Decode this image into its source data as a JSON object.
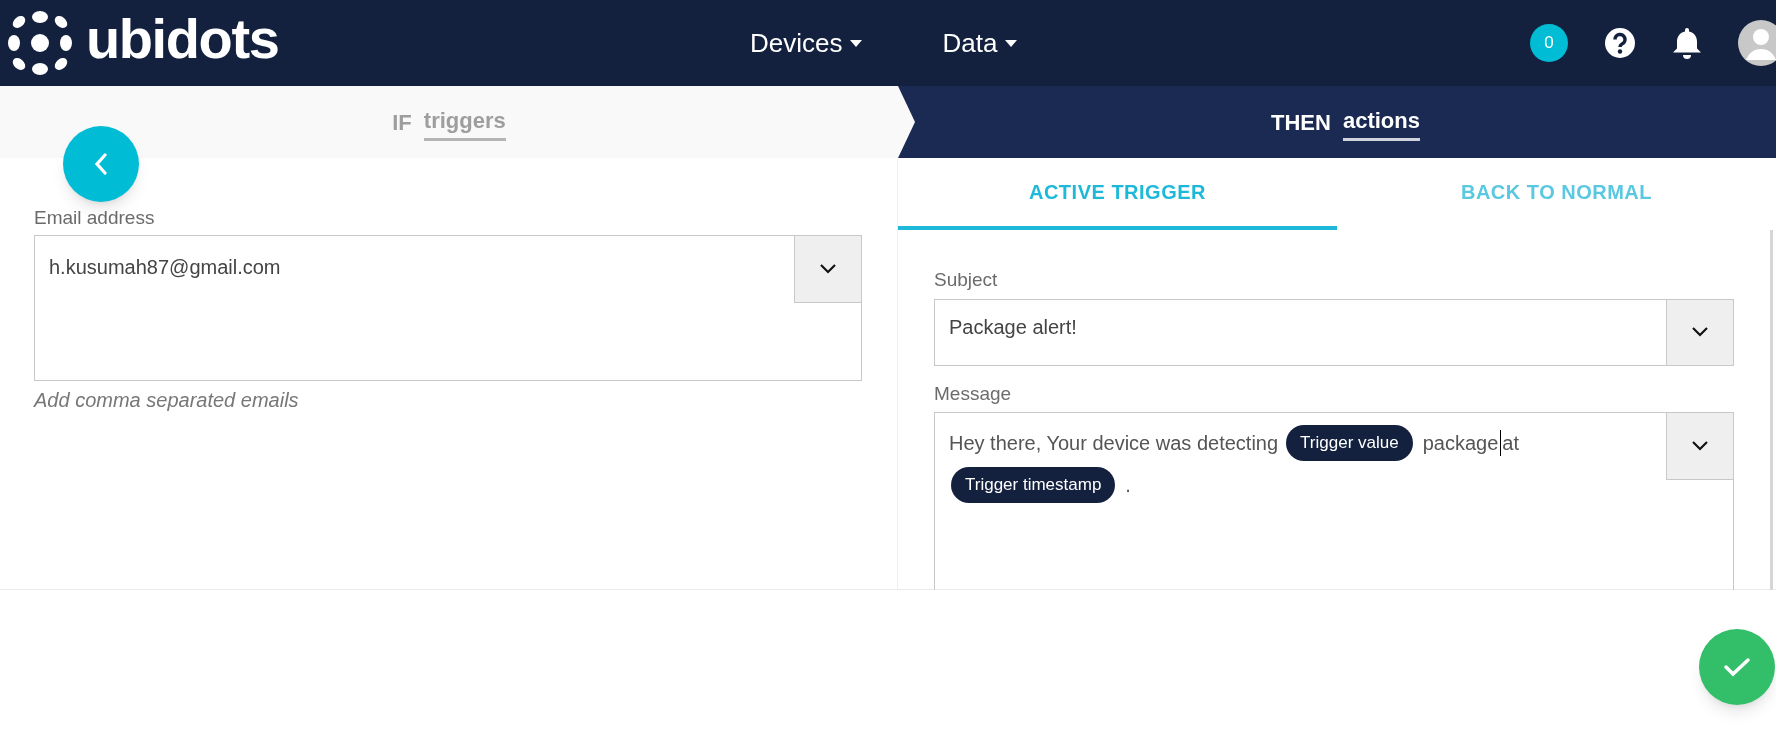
{
  "header": {
    "logo": "ubidots",
    "nav": [
      {
        "label": "Devices"
      },
      {
        "label": "Data"
      }
    ],
    "badge": "0"
  },
  "steps": [
    {
      "prefix": "IF",
      "label": "triggers",
      "selected": false
    },
    {
      "prefix": "THEN",
      "label": "actions",
      "selected": true
    }
  ],
  "left": {
    "label": "Email address",
    "value": "h.kusumah87@gmail.com",
    "helper": "Add comma separated emails"
  },
  "tabs": [
    {
      "label": "ACTIVE TRIGGER",
      "selected": true
    },
    {
      "label": "BACK TO NORMAL",
      "selected": false
    }
  ],
  "subject": {
    "label": "Subject",
    "value": "Package alert!"
  },
  "message": {
    "label": "Message",
    "segments": [
      {
        "kind": "text",
        "text": "Hey there, Your device was detecting"
      },
      {
        "kind": "chip",
        "text": "Trigger value"
      },
      {
        "kind": "text",
        "text": "package"
      },
      {
        "kind": "cursor"
      },
      {
        "kind": "text",
        "text": "at"
      },
      {
        "kind": "chip",
        "text": "Trigger timestamp"
      },
      {
        "kind": "text",
        "text": "."
      }
    ]
  }
}
